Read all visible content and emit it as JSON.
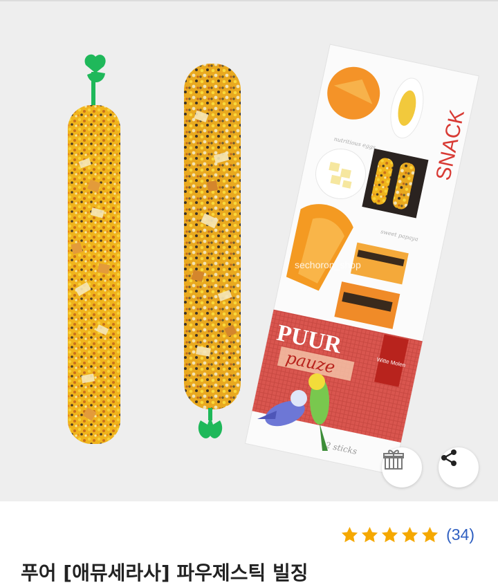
{
  "product_image": {
    "watermark": "sechoron_shop",
    "package": {
      "brand": "PUUR",
      "sub_brand": "pauze",
      "side_text": "SNACK",
      "count": "2 sticks",
      "logo": "Witte Molen",
      "caption_1": "nutritious eggs",
      "caption_2": "sweet papaya"
    }
  },
  "actions": {
    "gift_icon": "gift-icon",
    "share_icon": "share-icon"
  },
  "rating": {
    "stars": 5,
    "review_count": "(34)",
    "star_color": "#f5a800"
  },
  "product": {
    "title": "푸어 [애뮤세라사] 파우제스틱 빌징"
  },
  "colors": {
    "link_blue": "#2e5fc1",
    "hook_green": "#1fb85a",
    "image_bg": "#eeeeee"
  }
}
